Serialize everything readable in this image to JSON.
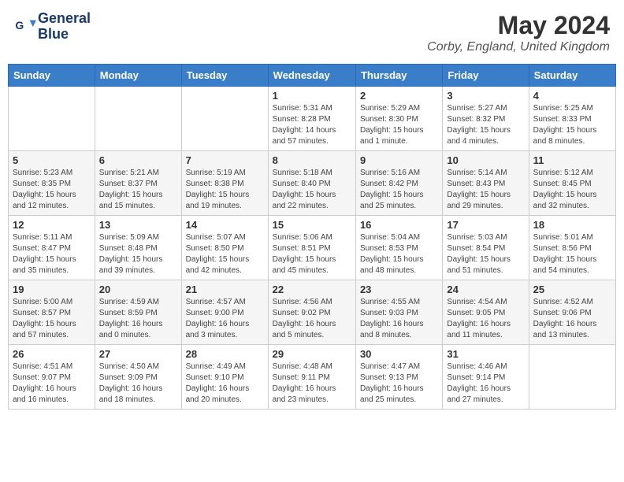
{
  "logo": {
    "line1": "General",
    "line2": "Blue"
  },
  "title": "May 2024",
  "subtitle": "Corby, England, United Kingdom",
  "days_of_week": [
    "Sunday",
    "Monday",
    "Tuesday",
    "Wednesday",
    "Thursday",
    "Friday",
    "Saturday"
  ],
  "weeks": [
    [
      {
        "day": "",
        "info": ""
      },
      {
        "day": "",
        "info": ""
      },
      {
        "day": "",
        "info": ""
      },
      {
        "day": "1",
        "info": "Sunrise: 5:31 AM\nSunset: 8:28 PM\nDaylight: 14 hours\nand 57 minutes."
      },
      {
        "day": "2",
        "info": "Sunrise: 5:29 AM\nSunset: 8:30 PM\nDaylight: 15 hours\nand 1 minute."
      },
      {
        "day": "3",
        "info": "Sunrise: 5:27 AM\nSunset: 8:32 PM\nDaylight: 15 hours\nand 4 minutes."
      },
      {
        "day": "4",
        "info": "Sunrise: 5:25 AM\nSunset: 8:33 PM\nDaylight: 15 hours\nand 8 minutes."
      }
    ],
    [
      {
        "day": "5",
        "info": "Sunrise: 5:23 AM\nSunset: 8:35 PM\nDaylight: 15 hours\nand 12 minutes."
      },
      {
        "day": "6",
        "info": "Sunrise: 5:21 AM\nSunset: 8:37 PM\nDaylight: 15 hours\nand 15 minutes."
      },
      {
        "day": "7",
        "info": "Sunrise: 5:19 AM\nSunset: 8:38 PM\nDaylight: 15 hours\nand 19 minutes."
      },
      {
        "day": "8",
        "info": "Sunrise: 5:18 AM\nSunset: 8:40 PM\nDaylight: 15 hours\nand 22 minutes."
      },
      {
        "day": "9",
        "info": "Sunrise: 5:16 AM\nSunset: 8:42 PM\nDaylight: 15 hours\nand 25 minutes."
      },
      {
        "day": "10",
        "info": "Sunrise: 5:14 AM\nSunset: 8:43 PM\nDaylight: 15 hours\nand 29 minutes."
      },
      {
        "day": "11",
        "info": "Sunrise: 5:12 AM\nSunset: 8:45 PM\nDaylight: 15 hours\nand 32 minutes."
      }
    ],
    [
      {
        "day": "12",
        "info": "Sunrise: 5:11 AM\nSunset: 8:47 PM\nDaylight: 15 hours\nand 35 minutes."
      },
      {
        "day": "13",
        "info": "Sunrise: 5:09 AM\nSunset: 8:48 PM\nDaylight: 15 hours\nand 39 minutes."
      },
      {
        "day": "14",
        "info": "Sunrise: 5:07 AM\nSunset: 8:50 PM\nDaylight: 15 hours\nand 42 minutes."
      },
      {
        "day": "15",
        "info": "Sunrise: 5:06 AM\nSunset: 8:51 PM\nDaylight: 15 hours\nand 45 minutes."
      },
      {
        "day": "16",
        "info": "Sunrise: 5:04 AM\nSunset: 8:53 PM\nDaylight: 15 hours\nand 48 minutes."
      },
      {
        "day": "17",
        "info": "Sunrise: 5:03 AM\nSunset: 8:54 PM\nDaylight: 15 hours\nand 51 minutes."
      },
      {
        "day": "18",
        "info": "Sunrise: 5:01 AM\nSunset: 8:56 PM\nDaylight: 15 hours\nand 54 minutes."
      }
    ],
    [
      {
        "day": "19",
        "info": "Sunrise: 5:00 AM\nSunset: 8:57 PM\nDaylight: 15 hours\nand 57 minutes."
      },
      {
        "day": "20",
        "info": "Sunrise: 4:59 AM\nSunset: 8:59 PM\nDaylight: 16 hours\nand 0 minutes."
      },
      {
        "day": "21",
        "info": "Sunrise: 4:57 AM\nSunset: 9:00 PM\nDaylight: 16 hours\nand 3 minutes."
      },
      {
        "day": "22",
        "info": "Sunrise: 4:56 AM\nSunset: 9:02 PM\nDaylight: 16 hours\nand 5 minutes."
      },
      {
        "day": "23",
        "info": "Sunrise: 4:55 AM\nSunset: 9:03 PM\nDaylight: 16 hours\nand 8 minutes."
      },
      {
        "day": "24",
        "info": "Sunrise: 4:54 AM\nSunset: 9:05 PM\nDaylight: 16 hours\nand 11 minutes."
      },
      {
        "day": "25",
        "info": "Sunrise: 4:52 AM\nSunset: 9:06 PM\nDaylight: 16 hours\nand 13 minutes."
      }
    ],
    [
      {
        "day": "26",
        "info": "Sunrise: 4:51 AM\nSunset: 9:07 PM\nDaylight: 16 hours\nand 16 minutes."
      },
      {
        "day": "27",
        "info": "Sunrise: 4:50 AM\nSunset: 9:09 PM\nDaylight: 16 hours\nand 18 minutes."
      },
      {
        "day": "28",
        "info": "Sunrise: 4:49 AM\nSunset: 9:10 PM\nDaylight: 16 hours\nand 20 minutes."
      },
      {
        "day": "29",
        "info": "Sunrise: 4:48 AM\nSunset: 9:11 PM\nDaylight: 16 hours\nand 23 minutes."
      },
      {
        "day": "30",
        "info": "Sunrise: 4:47 AM\nSunset: 9:13 PM\nDaylight: 16 hours\nand 25 minutes."
      },
      {
        "day": "31",
        "info": "Sunrise: 4:46 AM\nSunset: 9:14 PM\nDaylight: 16 hours\nand 27 minutes."
      },
      {
        "day": "",
        "info": ""
      }
    ]
  ],
  "accent_color": "#3a7dc9"
}
